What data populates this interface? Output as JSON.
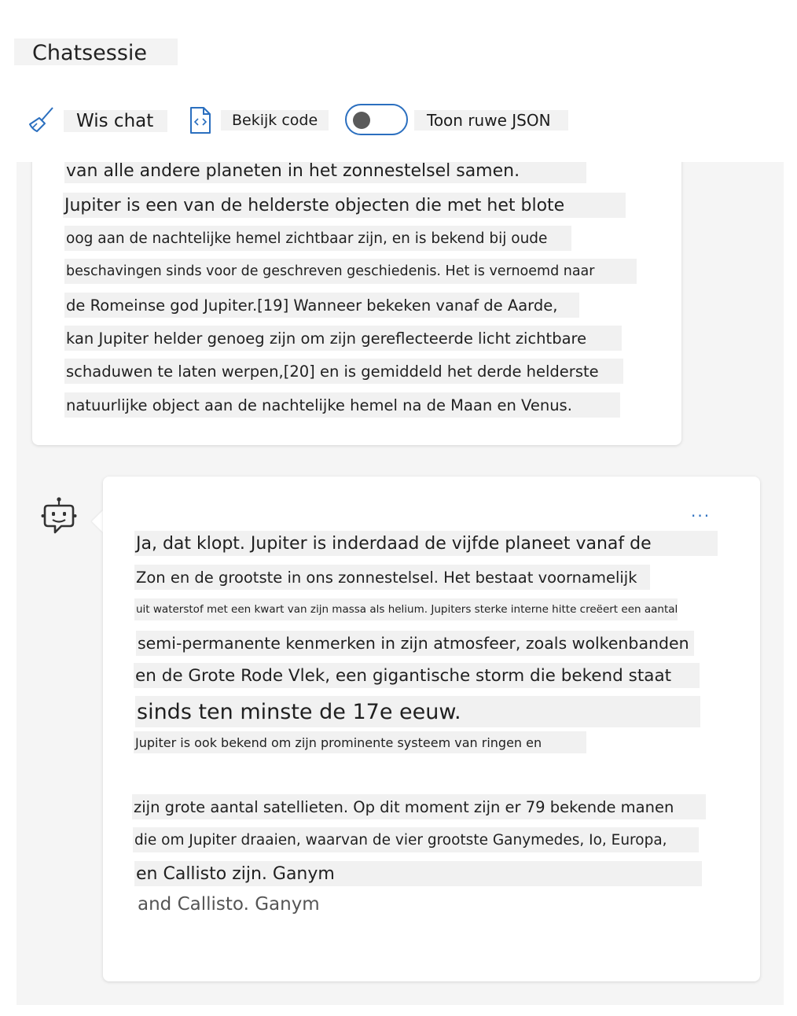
{
  "header": {
    "title": "Chatsessie"
  },
  "toolbar": {
    "clear_label": "Wis chat",
    "code_label": "Bekijk code",
    "raw_json_label": "Toon ruwe JSON",
    "raw_json_enabled": false
  },
  "user_message": {
    "lines": [
      "van alle andere planeten in het zonnestelsel samen.",
      "Jupiter is een van de helderste objecten die met het blote",
      "oog aan de nachtelijke hemel zichtbaar zijn, en is bekend bij oude",
      "beschavingen sinds voor de geschreven geschiedenis. Het is vernoemd naar",
      "de Romeinse god Jupiter.[19] Wanneer bekeken vanaf de Aarde,",
      "kan Jupiter helder genoeg zijn om zijn gereflecteerde licht zichtbare",
      "schaduwen te laten werpen,[20] en is gemiddeld het derde helderste",
      "natuurlijke object aan de nachtelijke hemel na de Maan en Venus."
    ]
  },
  "bot_message": {
    "more_label": "...",
    "lines": [
      "Ja, dat klopt. Jupiter is inderdaad de vijfde planeet vanaf de",
      "Zon en de grootste in ons zonnestelsel. Het bestaat voornamelijk",
      "uit waterstof met een kwart van zijn massa als helium. Jupiters sterke interne hitte creëert een aantal",
      "semi-permanente kenmerken in zijn atmosfeer, zoals wolkenbanden",
      "en de Grote Rode Vlek, een gigantische storm die bekend staat",
      "sinds ten minste de 17e eeuw.",
      "Jupiter is ook bekend om zijn prominente systeem van ringen en",
      "zijn grote aantal satellieten. Op dit moment zijn er 79 bekende manen",
      "die om Jupiter draaien, waarvan de vier grootste Ganymedes, Io, Europa,",
      "en Callisto zijn. Ganym"
    ],
    "trailing_text": "and Callisto. Ganym"
  }
}
